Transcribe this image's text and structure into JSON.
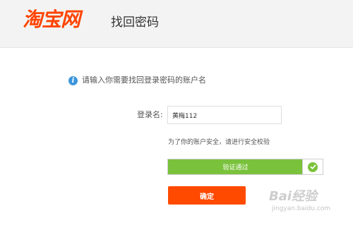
{
  "header": {
    "logo_text": "淘宝网",
    "title": "找回密码"
  },
  "notice": {
    "icon": "info-icon",
    "text": "请输入你需要找回登录密码的账户名"
  },
  "form": {
    "login_label": "登录名:",
    "login_value": "黄梅112",
    "security_hint": "为了你的账户安全，请进行安全校验",
    "verify_text": "验证通过",
    "verify_progress": 0.87,
    "confirm_label": "确定"
  },
  "watermark": {
    "main": "Bai经验",
    "sub": "jingyan.baidu.com"
  },
  "colors": {
    "brand": "#ff4400",
    "button": "#ff4a00",
    "success": "#7ac23c",
    "info": "#3c96dc"
  }
}
